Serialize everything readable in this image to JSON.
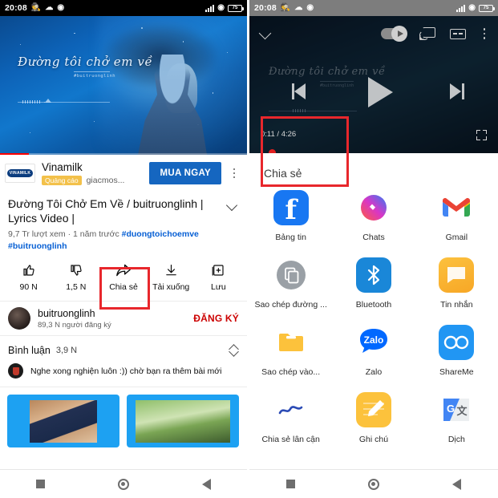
{
  "status_bar": {
    "time": "20:08",
    "left_icons": [
      "incognito-icon",
      "cloud-icon",
      "messenger-icon"
    ],
    "battery_text": "75",
    "right_icons": [
      "signal-icon",
      "wifi-icon",
      "battery-icon"
    ]
  },
  "left_panel": {
    "video": {
      "overlay_title": "Đường tôi chở em về",
      "overlay_hashtag": "#buitruonglinh"
    },
    "ad": {
      "logo_text": "VINAMILK",
      "advertiser": "Vinamilk",
      "badge": "Quảng cáo",
      "domain": "giacmos...",
      "cta": "MUA NGAY",
      "menu": "kebab-menu-icon"
    },
    "title": "Đường Tôi Chở Em Về / buitruonglinh | Lyrics Video |",
    "stats_views": "9,7 Tr lượt xem",
    "stats_sep": " · ",
    "stats_age": "1 năm trước",
    "hashtags": [
      "#duongtoichoemve",
      "#buitruonglinh"
    ],
    "actions": [
      {
        "icon": "thumbs-up-icon",
        "label": "90 N"
      },
      {
        "icon": "thumbs-down-icon",
        "label": "1,5 N"
      },
      {
        "icon": "share-arrow-icon",
        "label": "Chia sẻ",
        "highlighted": true
      },
      {
        "icon": "download-icon",
        "label": "Tải xuống"
      },
      {
        "icon": "save-playlist-icon",
        "label": "Lưu"
      }
    ],
    "channel": {
      "name": "buitruonglinh",
      "subscribers": "89,3 N người đăng ký",
      "subscribe_button": "ĐĂNG KÝ"
    },
    "comments": {
      "label": "Bình luận",
      "count": "3,9 N",
      "sort_icon": "sort-comments-icon",
      "top_comment": "Nghe xong nghiện luôn :)) chờ bạn ra thêm bài mới"
    },
    "nav": [
      "recents-square-icon",
      "home-circle-icon",
      "back-triangle-icon"
    ]
  },
  "right_panel": {
    "player": {
      "collapse_icon": "chevron-down-icon",
      "autoplay_toggle": "autoplay-toggle",
      "cast_icon": "cast-icon",
      "captions_icon": "closed-captions-icon",
      "menu_icon": "kebab-menu-icon",
      "overlay_title": "Đường tôi chở em về",
      "overlay_hashtag": "#buitruonglinh",
      "prev_icon": "previous-track-icon",
      "play_icon": "play-icon",
      "next_icon": "next-track-icon",
      "current_time": "0:11",
      "time_separator": " / ",
      "duration": "4:26",
      "fullscreen_icon": "fullscreen-icon"
    },
    "share_sheet": {
      "title": "Chia sẻ",
      "items": [
        {
          "icon": "facebook-icon",
          "label": "Bảng tin"
        },
        {
          "icon": "messenger-icon",
          "label": "Chats"
        },
        {
          "icon": "gmail-icon",
          "label": "Gmail"
        },
        {
          "icon": "copy-link-icon",
          "label": "Sao chép đường ...",
          "highlighted": true
        },
        {
          "icon": "bluetooth-icon",
          "label": "Bluetooth"
        },
        {
          "icon": "messages-icon",
          "label": "Tin nhắn"
        },
        {
          "icon": "folder-icon",
          "label": "Sao chép vào..."
        },
        {
          "icon": "zalo-icon",
          "label": "Zalo"
        },
        {
          "icon": "shareme-icon",
          "label": "ShareMe"
        },
        {
          "icon": "nearby-share-icon",
          "label": "Chia sẻ lân cận"
        },
        {
          "icon": "notes-icon",
          "label": "Ghi chú"
        },
        {
          "icon": "google-translate-icon",
          "label": "Dịch"
        }
      ]
    },
    "nav": [
      "recents-square-icon",
      "home-circle-icon",
      "back-triangle-icon"
    ]
  },
  "colors": {
    "highlight": "#e8272c",
    "youtube_red": "#cc0000",
    "link_blue": "#065fd4",
    "ad_blue": "#1566c0"
  }
}
